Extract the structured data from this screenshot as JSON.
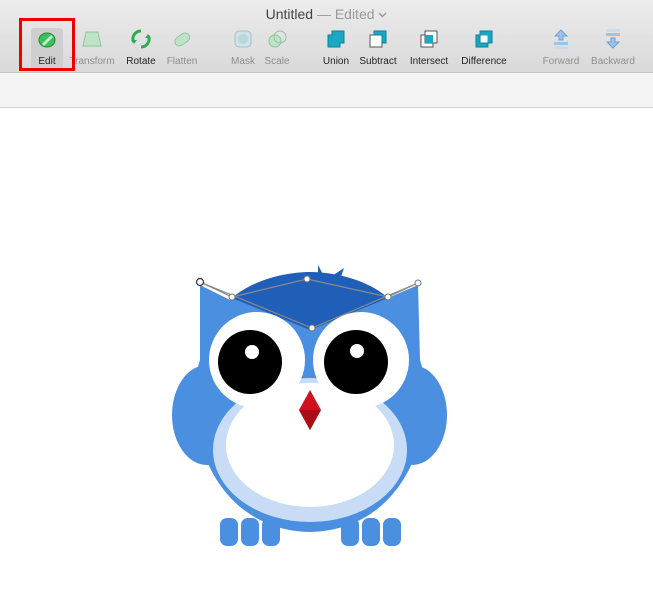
{
  "window": {
    "title": "Untitled",
    "status": "— Edited",
    "status_icon": "chevron-down-icon"
  },
  "toolbar": {
    "items": [
      {
        "label": "Edit",
        "icon": "edit-icon",
        "enabled": true,
        "selected": true
      },
      {
        "label": "Transform",
        "icon": "transform-icon",
        "enabled": false
      },
      {
        "label": "Rotate",
        "icon": "rotate-icon",
        "enabled": true
      },
      {
        "label": "Flatten",
        "icon": "flatten-icon",
        "enabled": false
      },
      {
        "label": "Mask",
        "icon": "mask-icon",
        "enabled": false
      },
      {
        "label": "Scale",
        "icon": "scale-icon",
        "enabled": false
      },
      {
        "label": "Union",
        "icon": "union-icon",
        "enabled": true
      },
      {
        "label": "Subtract",
        "icon": "subtract-icon",
        "enabled": true
      },
      {
        "label": "Intersect",
        "icon": "intersect-icon",
        "enabled": true
      },
      {
        "label": "Difference",
        "icon": "difference-icon",
        "enabled": true
      },
      {
        "label": "Forward",
        "icon": "forward-icon",
        "enabled": false
      },
      {
        "label": "Backward",
        "icon": "backward-icon",
        "enabled": false
      }
    ]
  },
  "canvas": {
    "artwork": "owl-illustration"
  },
  "colors": {
    "owl_blue": "#4a8fe0",
    "owl_dark_blue": "#1f5fb8",
    "belly": "#c9dcf5",
    "beak": "#d0121f",
    "highlight": "#ee0000",
    "tool_green": "#2fae4e",
    "tool_cyan": "#19a7c4"
  }
}
